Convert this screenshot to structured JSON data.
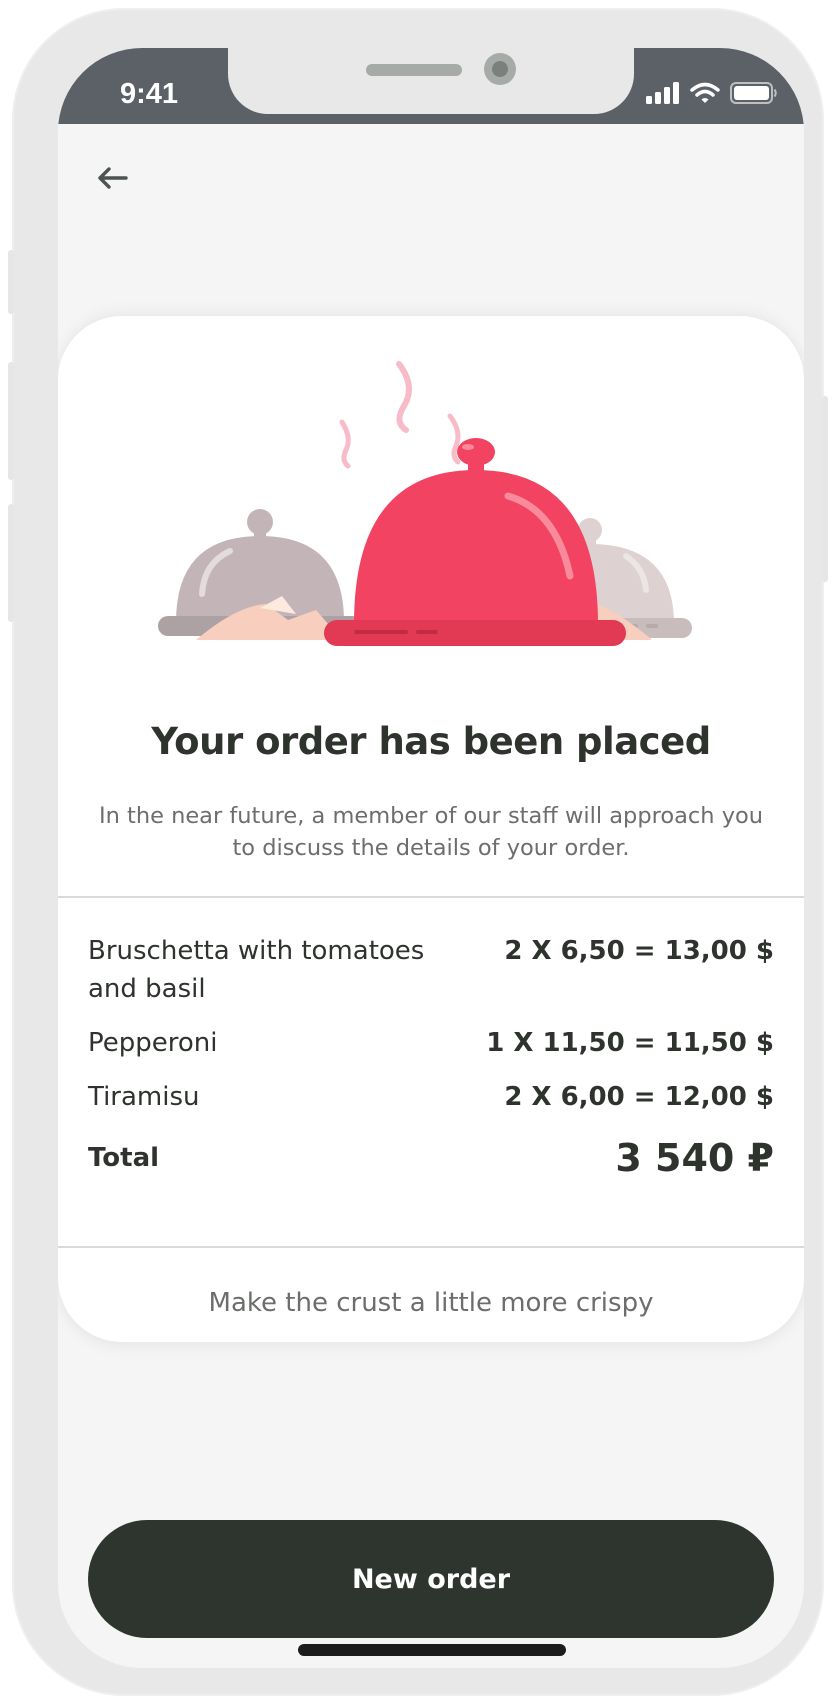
{
  "status_bar": {
    "time": "9:41"
  },
  "icons": {
    "back": "arrow-left-icon",
    "signal": "signal-icon",
    "wifi": "wifi-icon",
    "battery": "battery-icon",
    "illustration": "food-cloche-icon"
  },
  "confirmation": {
    "title": "Your order has been placed",
    "message": "In the near future, a member of our staff will approach you to discuss the details of your order."
  },
  "order": {
    "items": [
      {
        "name": "Bruschetta with tomatoes and basil",
        "price": "2 X 6,50 = 13,00 $"
      },
      {
        "name": "Pepperoni",
        "price": "1 X 11,50 = 11,50 $"
      },
      {
        "name": "Tiramisu",
        "price": "2 X 6,00 = 12,00 $"
      }
    ],
    "total_label": "Total",
    "total_value": "3 540 ₽",
    "comment": "Make the crust a little more crispy"
  },
  "actions": {
    "new_order_label": "New order"
  },
  "colors": {
    "accent": "#f24462",
    "primary_button": "#2e352f",
    "status_bar": "#5b6166",
    "text_dark": "#2e332e",
    "text_muted": "#6b6e6b"
  }
}
